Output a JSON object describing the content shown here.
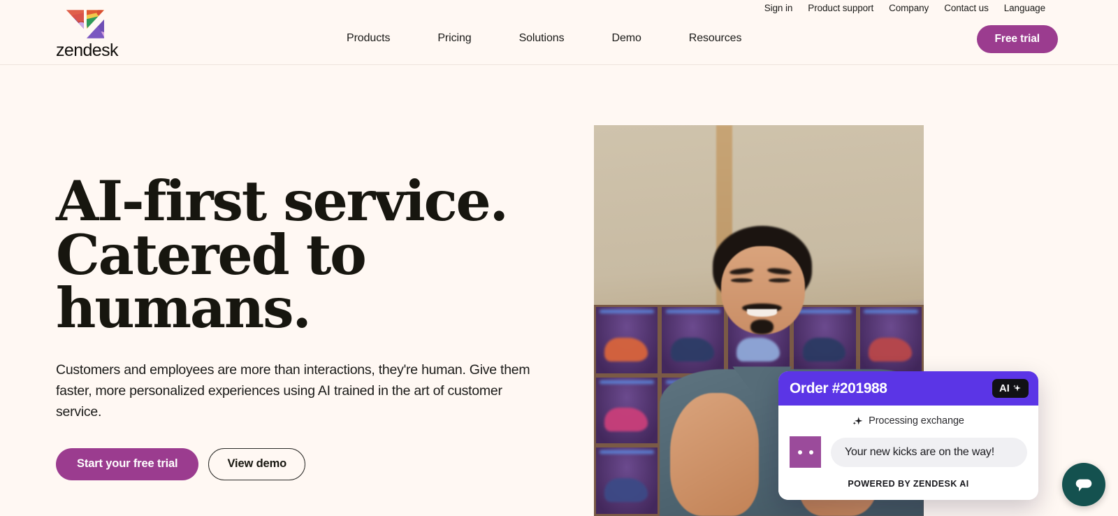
{
  "brand": {
    "name": "zendesk",
    "accent_purple": "#9B3C8F",
    "card_header_purple": "#5B35E6",
    "page_background": "#FFF8F3",
    "launcher_teal": "#14514F",
    "avatar_purple": "#9B4B9B"
  },
  "utility_nav": [
    {
      "label": "Sign in"
    },
    {
      "label": "Product support"
    },
    {
      "label": "Company"
    },
    {
      "label": "Contact us"
    },
    {
      "label": "Language"
    }
  ],
  "main_nav": [
    {
      "label": "Products"
    },
    {
      "label": "Pricing"
    },
    {
      "label": "Solutions"
    },
    {
      "label": "Demo"
    },
    {
      "label": "Resources"
    }
  ],
  "header": {
    "free_trial_label": "Free trial",
    "logo_word": "zendesk",
    "logo_icon": "zendesk-z-logo"
  },
  "hero": {
    "title_line1": "AI-first service.",
    "title_line2": "Catered to",
    "title_line3": "humans.",
    "subtitle": "Customers and employees are more than interactions, they're human. Give them faster, more personalized experiences using AI trained in the art of customer service.",
    "primary_cta": "Start your free trial",
    "secondary_cta": "View demo",
    "image_alt": "Smiling man in a sneaker store gesturing toward the camera"
  },
  "order_card": {
    "title": "Order #201988",
    "ai_badge": "AI",
    "ai_badge_icon": "sparkle-icon",
    "status": "Processing exchange",
    "status_icon": "sparkle-icon",
    "message": "Your new kicks are on the way!",
    "footer": "POWERED BY ZENDESK AI"
  },
  "chat_widget": {
    "icon": "chat-bubble-icon",
    "aria_label": "Open messaging window"
  }
}
